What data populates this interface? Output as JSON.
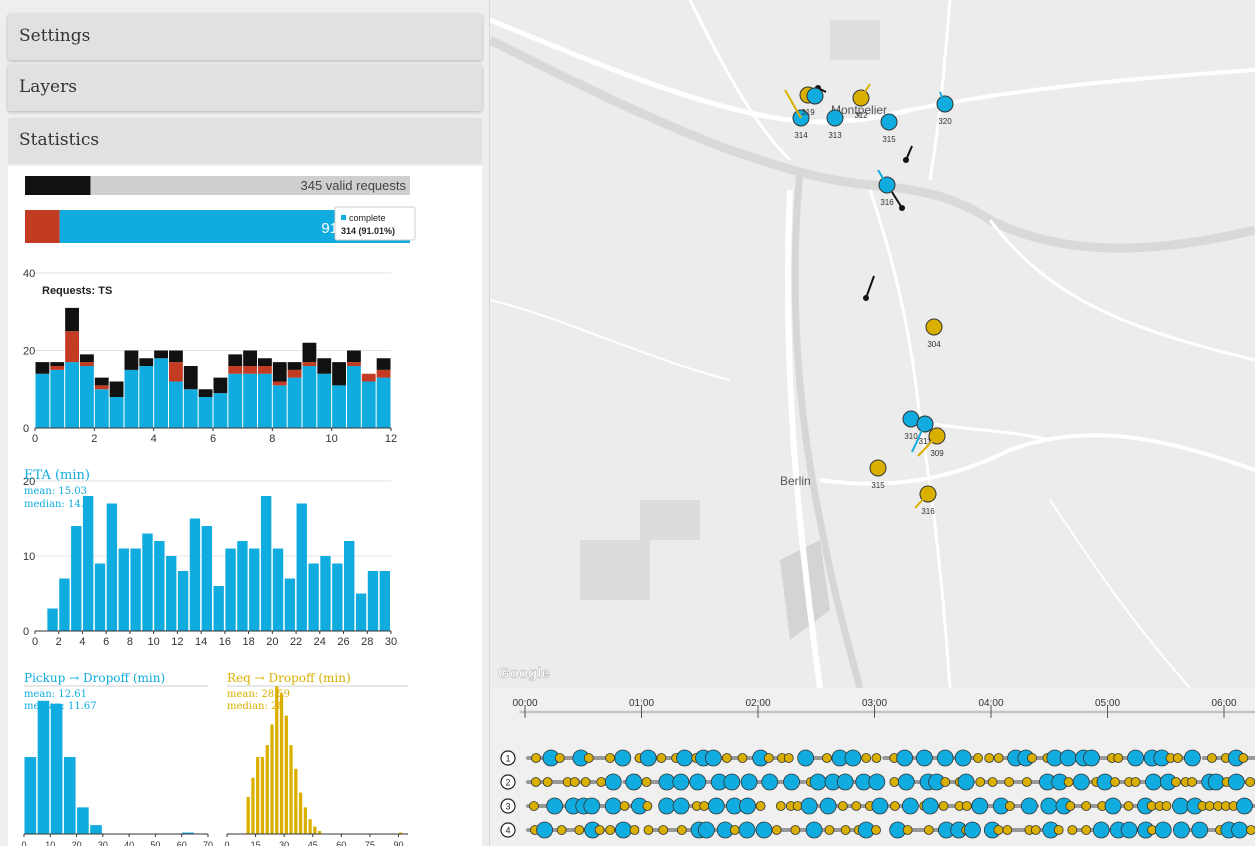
{
  "accordion": {
    "settings": "Settings",
    "layers": "Layers",
    "statistics": "Statistics"
  },
  "valid_bar": {
    "label": "345 valid requests",
    "dark_fraction": 0.17
  },
  "status_bar": {
    "visible_pct_label": "91",
    "red_fraction": 0.09,
    "complete_fraction": 0.91,
    "tooltip": {
      "label": "complete",
      "value": "314 (91.01%)"
    }
  },
  "colors": {
    "blue": "#10acdf",
    "red": "#c23b22",
    "black": "#111111",
    "yellow": "#d9b000",
    "bar_gray": "#cfcfcf"
  },
  "chart_data": [
    {
      "type": "bar",
      "title": "Requests: TS",
      "x_ticks": [
        "0",
        "2",
        "4",
        "6",
        "8",
        "10",
        "12"
      ],
      "y_ticks": [
        "40",
        "20",
        "0"
      ],
      "ylim": [
        0,
        40
      ],
      "xlim": [
        0,
        12
      ],
      "bin_width": 0.5,
      "stacked": true,
      "x": [
        0,
        0.5,
        1,
        1.5,
        2,
        2.5,
        3,
        3.5,
        4,
        4.5,
        5,
        5.5,
        6,
        6.5,
        7,
        7.5,
        8,
        8.5,
        9,
        9.5,
        10,
        10.5,
        11,
        11.5
      ],
      "series": [
        {
          "values": [
            14,
            15,
            17,
            16,
            10,
            8,
            15,
            16,
            18,
            12,
            10,
            8,
            9,
            14,
            14,
            14,
            11,
            13,
            16,
            14,
            11,
            16,
            12,
            13
          ],
          "color": "blue"
        },
        {
          "values": [
            0,
            1,
            8,
            1,
            1,
            0,
            0,
            0,
            0,
            5,
            0,
            0,
            0,
            2,
            2,
            2,
            1,
            2,
            1,
            0,
            0,
            1,
            2,
            2
          ],
          "color": "red"
        },
        {
          "values": [
            3,
            1,
            6,
            2,
            2,
            4,
            5,
            2,
            2,
            3,
            6,
            2,
            4,
            3,
            4,
            2,
            5,
            2,
            5,
            4,
            6,
            3,
            0,
            3
          ],
          "color": "black"
        }
      ]
    },
    {
      "type": "bar",
      "title": "ETA (min)",
      "mean_label": "mean: 15.03",
      "median_label": "median: 14.9",
      "x_ticks": [
        "0",
        "2",
        "4",
        "6",
        "8",
        "10",
        "12",
        "14",
        "16",
        "18",
        "20",
        "22",
        "24",
        "26",
        "28",
        "30"
      ],
      "y_ticks": [
        "20",
        "10",
        "0"
      ],
      "ylim": [
        0,
        20
      ],
      "xlim": [
        0,
        30
      ],
      "x": [
        1,
        2,
        3,
        4,
        5,
        6,
        7,
        8,
        9,
        10,
        11,
        12,
        13,
        14,
        15,
        16,
        17,
        18,
        19,
        20,
        21,
        22,
        23,
        24,
        25,
        26,
        27,
        28,
        29,
        30
      ],
      "values": [
        3,
        7,
        14,
        18,
        9,
        17,
        11,
        11,
        13,
        12,
        10,
        8,
        15,
        14,
        6,
        11,
        12,
        11,
        18,
        11,
        7,
        17,
        9,
        10,
        9,
        12,
        5,
        8,
        8,
        0
      ]
    },
    {
      "type": "bar",
      "title": "Pickup → Dropoff (min)",
      "mean_label": "mean: 12.61",
      "median_label": "median: 11.67",
      "x_ticks": [
        "0",
        "10",
        "20",
        "30",
        "40",
        "50",
        "60",
        "70"
      ],
      "ylim": [
        0,
        100
      ],
      "xlim": [
        0,
        70
      ],
      "x": [
        0,
        5,
        10,
        15,
        20,
        25,
        30,
        35,
        40,
        45,
        50,
        55,
        60,
        65
      ],
      "values": [
        52,
        90,
        88,
        52,
        18,
        6,
        0,
        0,
        0,
        0,
        0,
        0,
        1,
        0
      ]
    },
    {
      "type": "bar",
      "title": "Req → Dropoff (min)",
      "mean_label": "mean: 28.59",
      "median_label": "median: 28",
      "x_ticks": [
        "0",
        "15",
        "30",
        "45",
        "60",
        "75",
        "90"
      ],
      "ylim": [
        0,
        100
      ],
      "xlim": [
        0,
        95
      ],
      "x": [
        10,
        12.5,
        15,
        17.5,
        20,
        22.5,
        25,
        27.5,
        30,
        32.5,
        35,
        37.5,
        40,
        42.5,
        45,
        47.5,
        90
      ],
      "values": [
        25,
        38,
        52,
        52,
        60,
        74,
        100,
        95,
        80,
        60,
        44,
        28,
        18,
        10,
        5,
        2,
        1
      ]
    }
  ],
  "map": {
    "google_label": "Google",
    "places": [
      {
        "name": "Montpelier"
      },
      {
        "name": "Berlin"
      }
    ],
    "markers": [
      {
        "label": "314",
        "color": "blue"
      },
      {
        "label": "313",
        "color": "blue"
      },
      {
        "label": "312",
        "color": "yellow"
      },
      {
        "label": "315",
        "color": "blue"
      },
      {
        "label": "320",
        "color": "blue"
      },
      {
        "label": "316",
        "color": "blue"
      },
      {
        "label": "304",
        "color": "yellow"
      },
      {
        "label": "310",
        "color": "blue"
      },
      {
        "label": "311",
        "color": "blue"
      },
      {
        "label": "309",
        "color": "yellow"
      },
      {
        "label": "315",
        "color": "yellow"
      },
      {
        "label": "316",
        "color": "yellow"
      },
      {
        "label": "319",
        "color": "yellow"
      },
      {
        "label": "",
        "color": "blue"
      }
    ]
  },
  "timeline": {
    "ticks": [
      "00:00",
      "01:00",
      "02:00",
      "03:00",
      "04:00",
      "05:00",
      "06:00"
    ],
    "rows": [
      "1",
      "2",
      "3",
      "4"
    ]
  }
}
